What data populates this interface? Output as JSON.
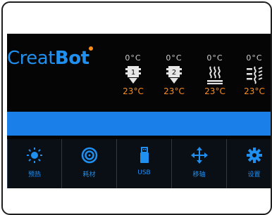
{
  "logo": {
    "part1": "Creat",
    "part2": "Bot"
  },
  "temperatures": [
    {
      "target": "0°C",
      "current": "23°C",
      "icon": "nozzle-1-icon"
    },
    {
      "target": "0°C",
      "current": "23°C",
      "icon": "nozzle-2-icon"
    },
    {
      "target": "0°C",
      "current": "23°C",
      "icon": "heated-bed-icon"
    },
    {
      "target": "0°C",
      "current": "23°C",
      "icon": "chamber-fan-icon"
    }
  ],
  "status_bar": {
    "text": ""
  },
  "menu": [
    {
      "label": "预热",
      "icon": "sun-icon"
    },
    {
      "label": "耗材",
      "icon": "filament-spool-icon"
    },
    {
      "label": "USB",
      "icon": "usb-drive-icon"
    },
    {
      "label": "移轴",
      "icon": "move-arrows-icon"
    },
    {
      "label": "设置",
      "icon": "gear-icon"
    }
  ],
  "colors": {
    "accent": "#1f8ff0",
    "status_bar": "#1a7fe8",
    "temperature_current": "#ff8c1a",
    "background": "#050505"
  }
}
